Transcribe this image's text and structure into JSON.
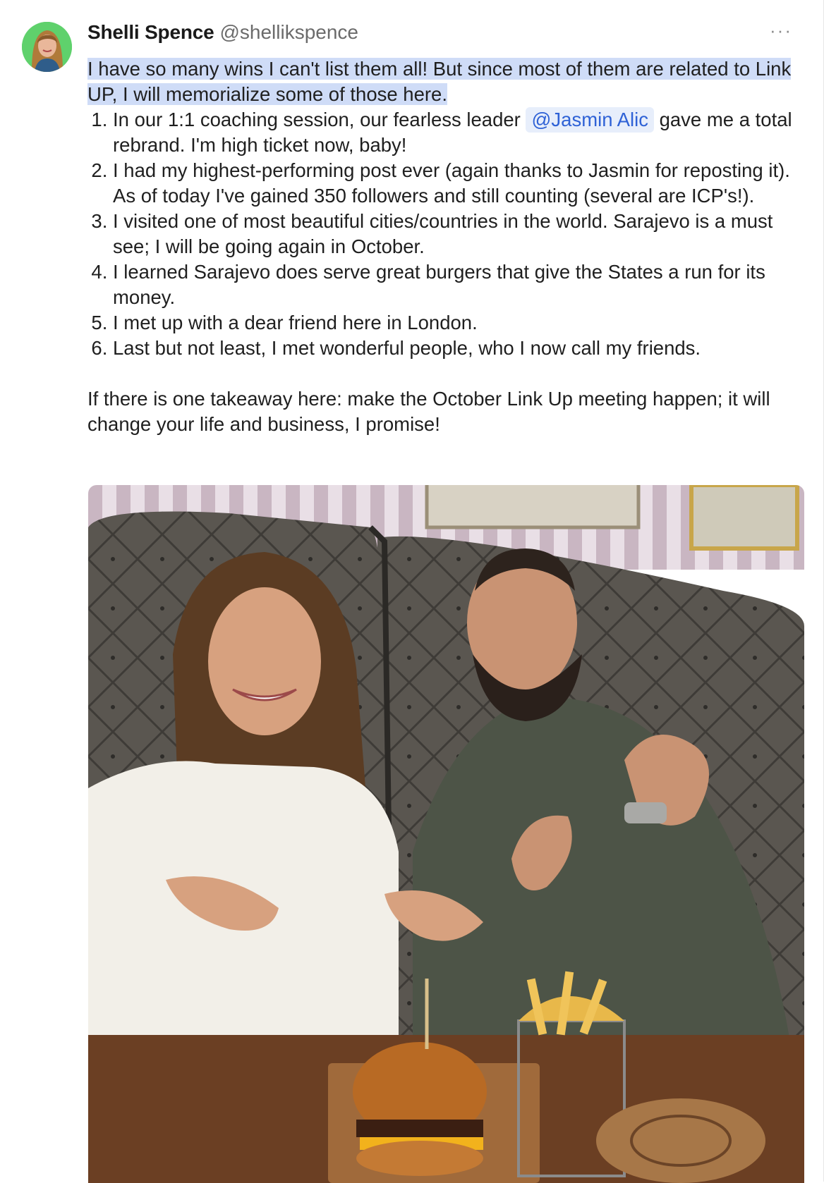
{
  "post": {
    "author": {
      "name": "Shelli Spence",
      "handle": "@shellikspence",
      "avatar_icon": "profile-avatar"
    },
    "menu_icon": "more-horizontal-icon",
    "intro_text": "I have so many wins I can't list them all! But since most of them are related to Link UP, I will memorialize some of those here.",
    "wins": [
      {
        "before": "In our 1:1 coaching session, our fearless leader ",
        "mention": "@Jasmin Alic",
        "after": " gave me a total rebrand. I'm high ticket now, baby!"
      },
      {
        "before": "I had my highest-performing post ever (again thanks to Jasmin for reposting it). As of today I've gained 350 followers and still counting (several are ICP's!).",
        "mention": "",
        "after": ""
      },
      {
        "before": "I visited one of most beautiful cities/countries in the world. Sarajevo is a must see; I will be going again in October.",
        "mention": "",
        "after": ""
      },
      {
        "before": "I learned Sarajevo does serve great burgers that give the States a run for its money.",
        "mention": "",
        "after": ""
      },
      {
        "before": "I met up with a dear friend here in London.",
        "mention": "",
        "after": ""
      },
      {
        "before": "Last but not least, I met wonderful people, who I now call my friends.",
        "mention": "",
        "after": ""
      }
    ],
    "takeaway_text": "If there is one takeaway here: make the October Link Up meeting happen; it will change your life and business, I promise!",
    "photo": {
      "description_icon": "post-photo"
    },
    "colors": {
      "mention_text": "#2f62d6",
      "mention_bg": "#e7eefb",
      "selection": "#cfdcf7",
      "avatar_bg": "#5fd16c"
    }
  }
}
